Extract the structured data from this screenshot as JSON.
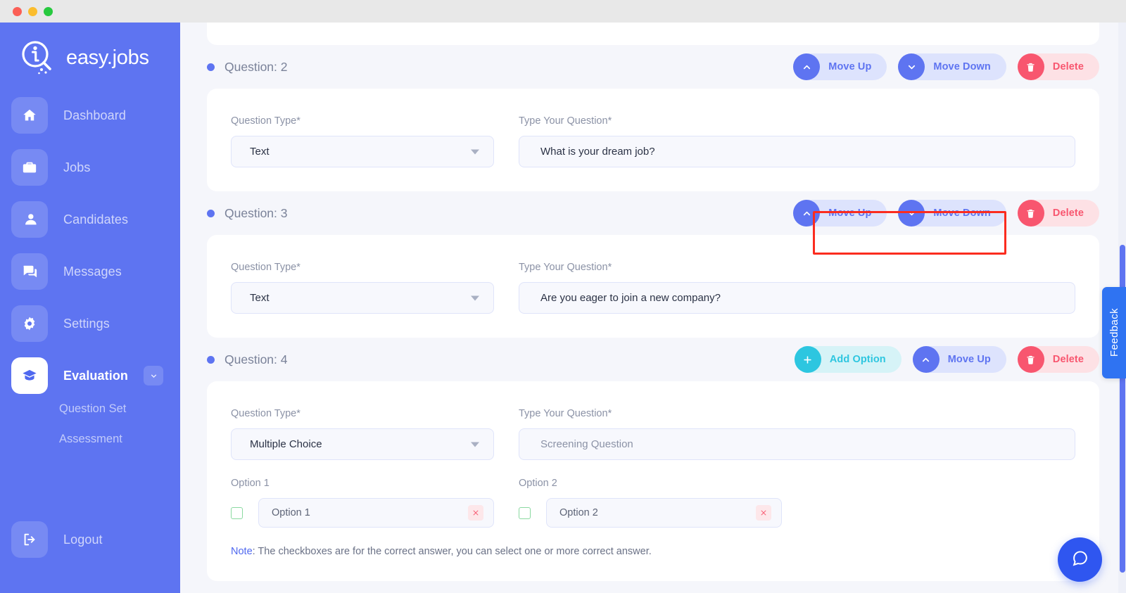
{
  "window": {
    "traffic_lights": [
      "close",
      "minimize",
      "maximize"
    ]
  },
  "sidebar": {
    "brand": "easy.jobs",
    "items": [
      {
        "label": "Dashboard",
        "icon": "home-icon",
        "active": false
      },
      {
        "label": "Jobs",
        "icon": "briefcase-icon",
        "active": false
      },
      {
        "label": "Candidates",
        "icon": "user-icon",
        "active": false
      },
      {
        "label": "Messages",
        "icon": "chat-icon",
        "active": false
      },
      {
        "label": "Settings",
        "icon": "gear-icon",
        "active": false
      },
      {
        "label": "Evaluation",
        "icon": "graduation-cap-icon",
        "active": true
      }
    ],
    "subitems": [
      {
        "label": "Question Set"
      },
      {
        "label": "Assessment"
      }
    ],
    "logout": {
      "label": "Logout",
      "icon": "logout-icon"
    }
  },
  "labels": {
    "question_type": "Question Type*",
    "type_your_question": "Type Your Question*",
    "note_prefix": "Note",
    "note_body": ": The checkboxes are for the correct answer, you can select one or more correct answer."
  },
  "buttons": {
    "move_up": "Move Up",
    "move_down": "Move Down",
    "delete": "Delete",
    "add_option": "Add Option"
  },
  "questions": [
    {
      "title": "Question: 2",
      "type_value": "Text",
      "question_value": "What is your dream job?",
      "question_is_placeholder": false,
      "actions": [
        "move_up",
        "move_down",
        "delete"
      ]
    },
    {
      "title": "Question: 3",
      "type_value": "Text",
      "question_value": "Are you eager to join a new company?",
      "question_is_placeholder": false,
      "actions": [
        "move_up",
        "move_down",
        "delete"
      ],
      "highlighted_actions": true
    },
    {
      "title": "Question: 4",
      "type_value": "Multiple Choice",
      "question_value": "Screening Question",
      "question_is_placeholder": true,
      "actions": [
        "add_option",
        "move_up",
        "delete"
      ],
      "options": [
        {
          "label": "Option 1",
          "value": "Option 1",
          "checked": false
        },
        {
          "label": "Option 2",
          "value": "Option 2",
          "checked": false
        }
      ]
    }
  ],
  "feedback": {
    "label": "Feedback"
  },
  "chat": {
    "icon": "chat-bubble-icon"
  },
  "colors": {
    "sidebar": "#5e74f1",
    "accent": "#5e74f1",
    "danger": "#f8566f",
    "cyan": "#2dc6e0",
    "highlight": "#fb2c1f",
    "page_bg": "#f5f6fb"
  }
}
